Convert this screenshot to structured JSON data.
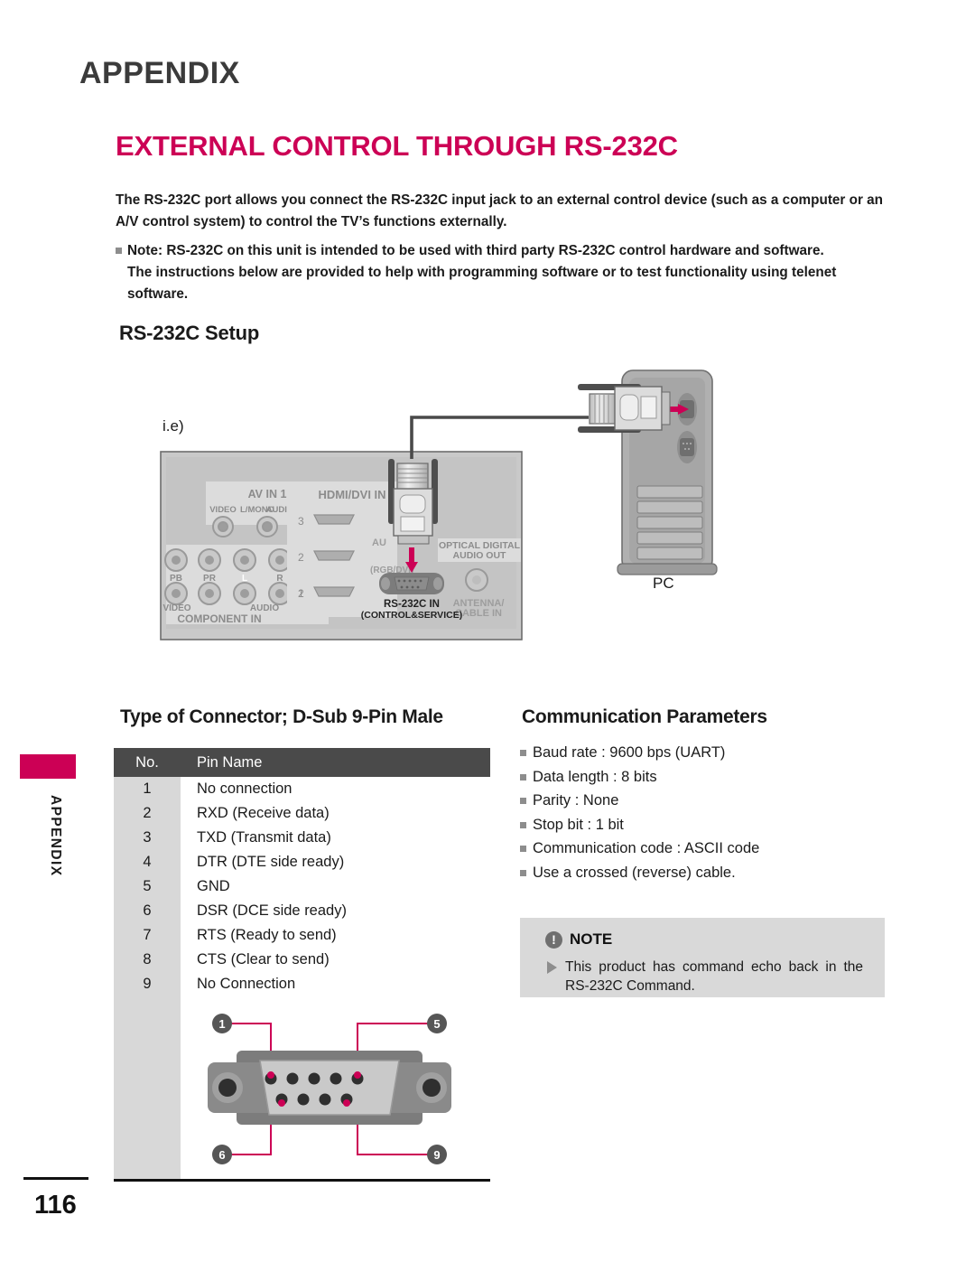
{
  "header": {
    "appendix": "APPENDIX",
    "title": "EXTERNAL CONTROL THROUGH RS-232C"
  },
  "intro": {
    "paragraph1": "The RS-232C port allows you connect the RS-232C input jack to an external control device (such as a computer or an A/V control system) to control the TV’s functions externally.",
    "note_bullet": "Note: RS-232C on this unit is intended to be used with third party RS-232C control hardware and software.",
    "note_cont": "The instructions below are provided to help with programming software or to test functionality using telenet software."
  },
  "setup": {
    "heading": "RS-232C Setup",
    "ie_label": "i.e)",
    "pc_label": "PC",
    "tv_panel": {
      "av_in_1": "AV IN 1",
      "hdmi_dvi_in": "HDMI/DVI IN",
      "video": "VIDEO",
      "audio_l_mono": "L/MONO",
      "audio_label": "AUDIO",
      "audio_r": "R",
      "component_in": "COMPONENT IN",
      "pb": "PB",
      "pr": "PR",
      "l": "L",
      "r": "R",
      "video2": "VIDEO",
      "audio2": "AUDIO",
      "hdmi_3": "3",
      "hdmi_2": "2",
      "hdmi_1": "1",
      "audio_in": "AU",
      "rgb_dvi": "(RGB/DVI)",
      "optical": "OPTICAL DIGITAL",
      "optical2": "AUDIO OUT",
      "rs232c_in": "RS-232C IN",
      "rs232c_sub": "(CONTROL&SERVICE)",
      "antenna": "ANTENNA/",
      "antenna2": "CABLE IN"
    }
  },
  "connector": {
    "heading": "Type of Connector; D-Sub 9-Pin Male",
    "columns": [
      "No.",
      "Pin Name"
    ],
    "rows": [
      {
        "no": "1",
        "name": "No connection"
      },
      {
        "no": "2",
        "name": "RXD (Receive data)"
      },
      {
        "no": "3",
        "name": "TXD (Transmit data)"
      },
      {
        "no": "4",
        "name": "DTR (DTE side ready)"
      },
      {
        "no": "5",
        "name": "GND"
      },
      {
        "no": "6",
        "name": "DSR (DCE side ready)"
      },
      {
        "no": "7",
        "name": "RTS (Ready to send)"
      },
      {
        "no": "8",
        "name": "CTS (Clear to send)"
      },
      {
        "no": "9",
        "name": "No Connection"
      }
    ],
    "callouts": {
      "tl": "1",
      "tr": "5",
      "bl": "6",
      "br": "9"
    }
  },
  "communication": {
    "heading": "Communication Parameters",
    "items": [
      "Baud rate : 9600 bps (UART)",
      "Data length : 8 bits",
      "Parity : None",
      "Stop bit : 1 bit",
      "Communication code : ASCII code",
      "Use a crossed (reverse) cable."
    ]
  },
  "note": {
    "icon": "!",
    "title": "NOTE",
    "text": "This product has command echo back in the RS-232C Command."
  },
  "footer": {
    "side_label": "APPENDIX",
    "page_number": "116"
  },
  "colors": {
    "accent": "#cc0055",
    "table_header": "#4a4a4a",
    "table_col": "#d8d8d8",
    "note_bg": "#d9d9d9"
  }
}
